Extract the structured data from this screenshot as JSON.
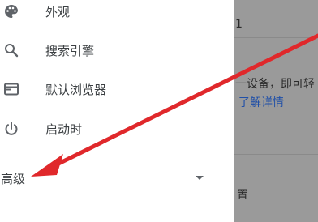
{
  "sidebar": {
    "items": [
      {
        "icon": "palette-icon",
        "label": "外观"
      },
      {
        "icon": "search-icon",
        "label": "搜索引擎"
      },
      {
        "icon": "browser-window-icon",
        "label": "默认浏览器"
      },
      {
        "icon": "power-icon",
        "label": "启动时"
      }
    ],
    "advanced_label": "高级",
    "advanced_icon": "caret-down-icon"
  },
  "content": {
    "top_number": "1",
    "device_text": "一设备，即可轻",
    "learn_more": "了解详情",
    "bottom_text": "置"
  },
  "annotation": {
    "arrow_color": "#e0282b"
  }
}
